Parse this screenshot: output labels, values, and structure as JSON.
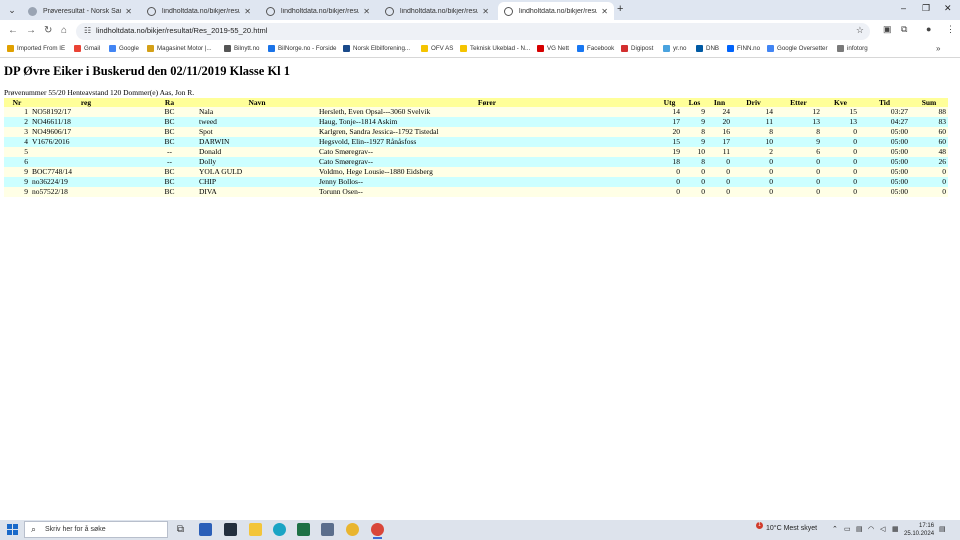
{
  "browser": {
    "tabs": [
      {
        "title": "Prøveresultat - Norsk Sau og Ge",
        "active": false
      },
      {
        "title": "lindholtdata.no/bikjer/resultat/",
        "active": false
      },
      {
        "title": "lindholtdata.no/bikjer/resultat/",
        "active": false
      },
      {
        "title": "lindholtdata.no/bikjer/resultat/",
        "active": false
      },
      {
        "title": "lindholtdata.no/bikjer/resultat/",
        "active": true
      }
    ],
    "url": "lindholtdata.no/bikjer/resultat/Res_2019-55_20.html",
    "bookmarks": [
      "Imported From IE",
      "Gmail",
      "Google",
      "Magasinet Motor |...",
      "Bilnytt.no",
      "BilNorge.no - Forside",
      "Norsk Elbilforening...",
      "OFV AS",
      "Teknisk Ukeblad - N...",
      "VG Nett",
      "Facebook",
      "Digipost",
      "yr.no",
      "DNB",
      "FINN.no",
      "Google Oversetter",
      "infotorg"
    ],
    "bookmark_colors": [
      "#e0a000",
      "#ea4335",
      "#4285f4",
      "#d4a017",
      "#555555",
      "#1a73e8",
      "#1a4a8a",
      "#f5c400",
      "#f5c400",
      "#d60000",
      "#1877f2",
      "#d32f2f",
      "#4aa3df",
      "#005aa4",
      "#0063fb",
      "#4285f4",
      "#7a7a7a"
    ]
  },
  "page": {
    "title": "DP Øvre Eiker i Buskerud den 02/11/2019 Klasse Kl 1",
    "info": "Prøvenummer 55/20 Henteavstand 120 Dommer(e) Aas, Jon R.",
    "columns": [
      "Nr",
      "reg",
      "Ra",
      "Navn",
      "Fører",
      "Utg",
      "Los",
      "Inn",
      "Driv",
      "Etter",
      "Kve",
      "Tid",
      "Sum"
    ],
    "rows": [
      [
        "1",
        "NO58192/17",
        "BC",
        "Nala",
        "Hersleth, Even Opsal---3060 Svelvik",
        "14",
        "9",
        "24",
        "14",
        "12",
        "15",
        "03:27",
        "88"
      ],
      [
        "2",
        "NO46611/18",
        "BC",
        "tweed",
        "Haug, Tonje--1814 Askim",
        "17",
        "9",
        "20",
        "11",
        "13",
        "13",
        "04:27",
        "83"
      ],
      [
        "3",
        "NO49606/17",
        "BC",
        "Spot",
        "Karlgren, Sandra Jessica--1792 Tistedal",
        "20",
        "8",
        "16",
        "8",
        "8",
        "0",
        "05:00",
        "60"
      ],
      [
        "4",
        "V1676/2016",
        "BC",
        "DARWIN",
        "Hegsvold, Elin--1927 Rånåsfoss",
        "15",
        "9",
        "17",
        "10",
        "9",
        "0",
        "05:00",
        "60"
      ],
      [
        "5",
        "",
        "--",
        "Donald",
        "Cato Smøregrav--",
        "19",
        "10",
        "11",
        "2",
        "6",
        "0",
        "05:00",
        "48"
      ],
      [
        "6",
        "",
        "--",
        "Dolly",
        "Cato Smøregrav--",
        "18",
        "8",
        "0",
        "0",
        "0",
        "0",
        "05:00",
        "26"
      ],
      [
        "9",
        "BOC7748/14",
        "BC",
        "YOLA GULD",
        "Voldmo, Hege Lousie--1880 Eidsberg",
        "0",
        "0",
        "0",
        "0",
        "0",
        "0",
        "05:00",
        "0"
      ],
      [
        "9",
        "no36224/19",
        "BC",
        "CHIP",
        "Jenny Bollos--",
        "0",
        "0",
        "0",
        "0",
        "0",
        "0",
        "05:00",
        "0"
      ],
      [
        "9",
        "no57522/18",
        "BC",
        "DIVA",
        "Torunn Osen--",
        "0",
        "0",
        "0",
        "0",
        "0",
        "0",
        "05:00",
        "0"
      ]
    ]
  },
  "taskbar": {
    "search_placeholder": "Skriv her for å søke",
    "weather": "10°C  Mest skyet",
    "weather_badge": "1",
    "time": "17:16",
    "date": "25.10.2024"
  }
}
